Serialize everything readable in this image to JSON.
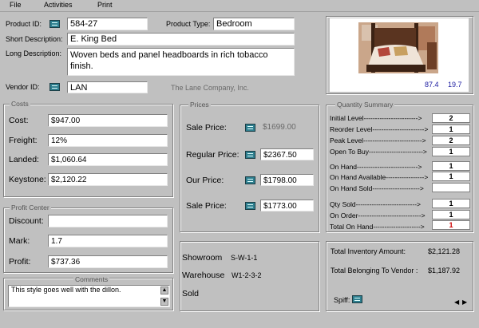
{
  "menu": [
    "File",
    "Activities",
    "Print"
  ],
  "product": {
    "id_label": "Product ID:",
    "id_value": "584-27",
    "type_label": "Product Type:",
    "type_value": "Bedroom",
    "short_label": "Short Description:",
    "short_value": "E. King Bed",
    "long_label": "Long Description:",
    "long_value": "Woven beds and panel headboards in rich tobacco finish.",
    "vendor_label": "Vendor ID:",
    "vendor_value": "LAN",
    "vendor_name": "The Lane Company, Inc."
  },
  "image_panel": {
    "value_a": "87.4",
    "value_b": "19.7"
  },
  "costs": {
    "title": "Costs",
    "rows": [
      {
        "label": "Cost:",
        "value": "$947.00"
      },
      {
        "label": "Freight:",
        "value": "12%"
      },
      {
        "label": "Landed:",
        "value": "$1,060.64"
      },
      {
        "label": "Keystone:",
        "value": "$2,120.22"
      }
    ]
  },
  "profit_center": {
    "title": "Profit Center",
    "rows": [
      {
        "label": "Discount:",
        "value": ""
      },
      {
        "label": "Mark:",
        "value": "1.7"
      },
      {
        "label": "Profit:",
        "value": "$737.36"
      }
    ]
  },
  "comments": {
    "title": "Comments",
    "text": "This style goes well with the dillon."
  },
  "prices": {
    "title": "Prices",
    "sale_static_label": "Sale Price:",
    "sale_static_value": "$1699.00",
    "rows": [
      {
        "label": "Regular Price:",
        "value": "$2367.50"
      },
      {
        "label": "Our Price:",
        "value": "$1798.00"
      },
      {
        "label": "Sale Price:",
        "value": "$1773.00"
      }
    ]
  },
  "location": {
    "showroom_label": "Showroom",
    "showroom_value": "S-W-1-1",
    "warehouse_label": "Warehouse",
    "warehouse_value": "W1-2-3-2",
    "sold_label": "Sold"
  },
  "quantity": {
    "title": "Quantity Summary",
    "rows": [
      {
        "label": "Initial Level------------------------>",
        "value": "2"
      },
      {
        "label": "Reorder Level----------------------->",
        "value": "1"
      },
      {
        "label": "Peak Level-------------------------->",
        "value": "2"
      },
      {
        "label": "Open To Buy------------------------>",
        "value": "1"
      },
      {
        "label": "On Hand--------------------------->",
        "value": "1"
      },
      {
        "label": "On Hand Available----------------->",
        "value": "1"
      },
      {
        "label": "On Hand Sold--------------------->",
        "value": ""
      },
      {
        "label": "Qty Sold--------------------------->",
        "value": "1"
      },
      {
        "label": "On Order---------------------------->",
        "value": "1"
      },
      {
        "label": "Total On Hand--------------------->",
        "value": "1"
      }
    ]
  },
  "totals": {
    "inventory_label": "Total Inventory Amount:",
    "inventory_value": "$2,121.28",
    "vendor_label": "Total Belonging To Vendor :",
    "vendor_value": "$1,187.92",
    "spiff_label": "Spiff:"
  },
  "colors": {
    "red_value": "#cc0000"
  }
}
